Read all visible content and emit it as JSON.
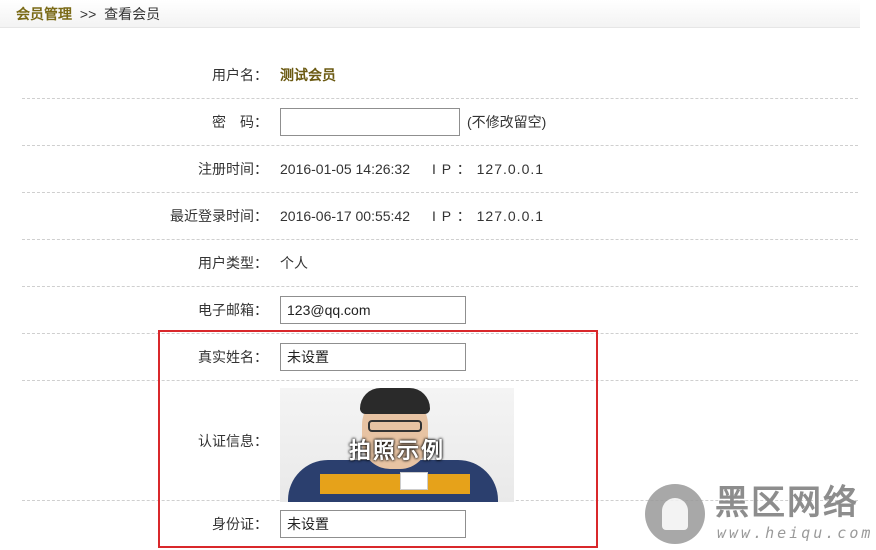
{
  "breadcrumb": {
    "parent": "会员管理",
    "separator": ">>",
    "current": "查看会员"
  },
  "form": {
    "username": {
      "label": "用户名：",
      "value": "测试会员"
    },
    "password": {
      "label": "密　码：",
      "value": "",
      "hint": "(不修改留空)"
    },
    "register": {
      "label": "注册时间：",
      "value": "2016-01-05 14:26:32",
      "ip": "I P ： 127.0.0.1"
    },
    "last_login": {
      "label": "最近登录时间：",
      "value": "2016-06-17 00:55:42",
      "ip": "I P ： 127.0.0.1"
    },
    "user_type": {
      "label": "用户类型：",
      "value": "个人"
    },
    "email": {
      "label": "电子邮箱：",
      "value": "123@qq.com"
    },
    "real_name": {
      "label": "真实姓名：",
      "value": "未设置"
    },
    "verification": {
      "label": "认证信息：",
      "photo_caption": "拍照示例"
    },
    "id_card": {
      "label": "身份证：",
      "value": "未设置"
    }
  },
  "highlight_color": "#d9282b",
  "watermark": {
    "title": "黑区网络",
    "url": "www.heiqu.com"
  }
}
